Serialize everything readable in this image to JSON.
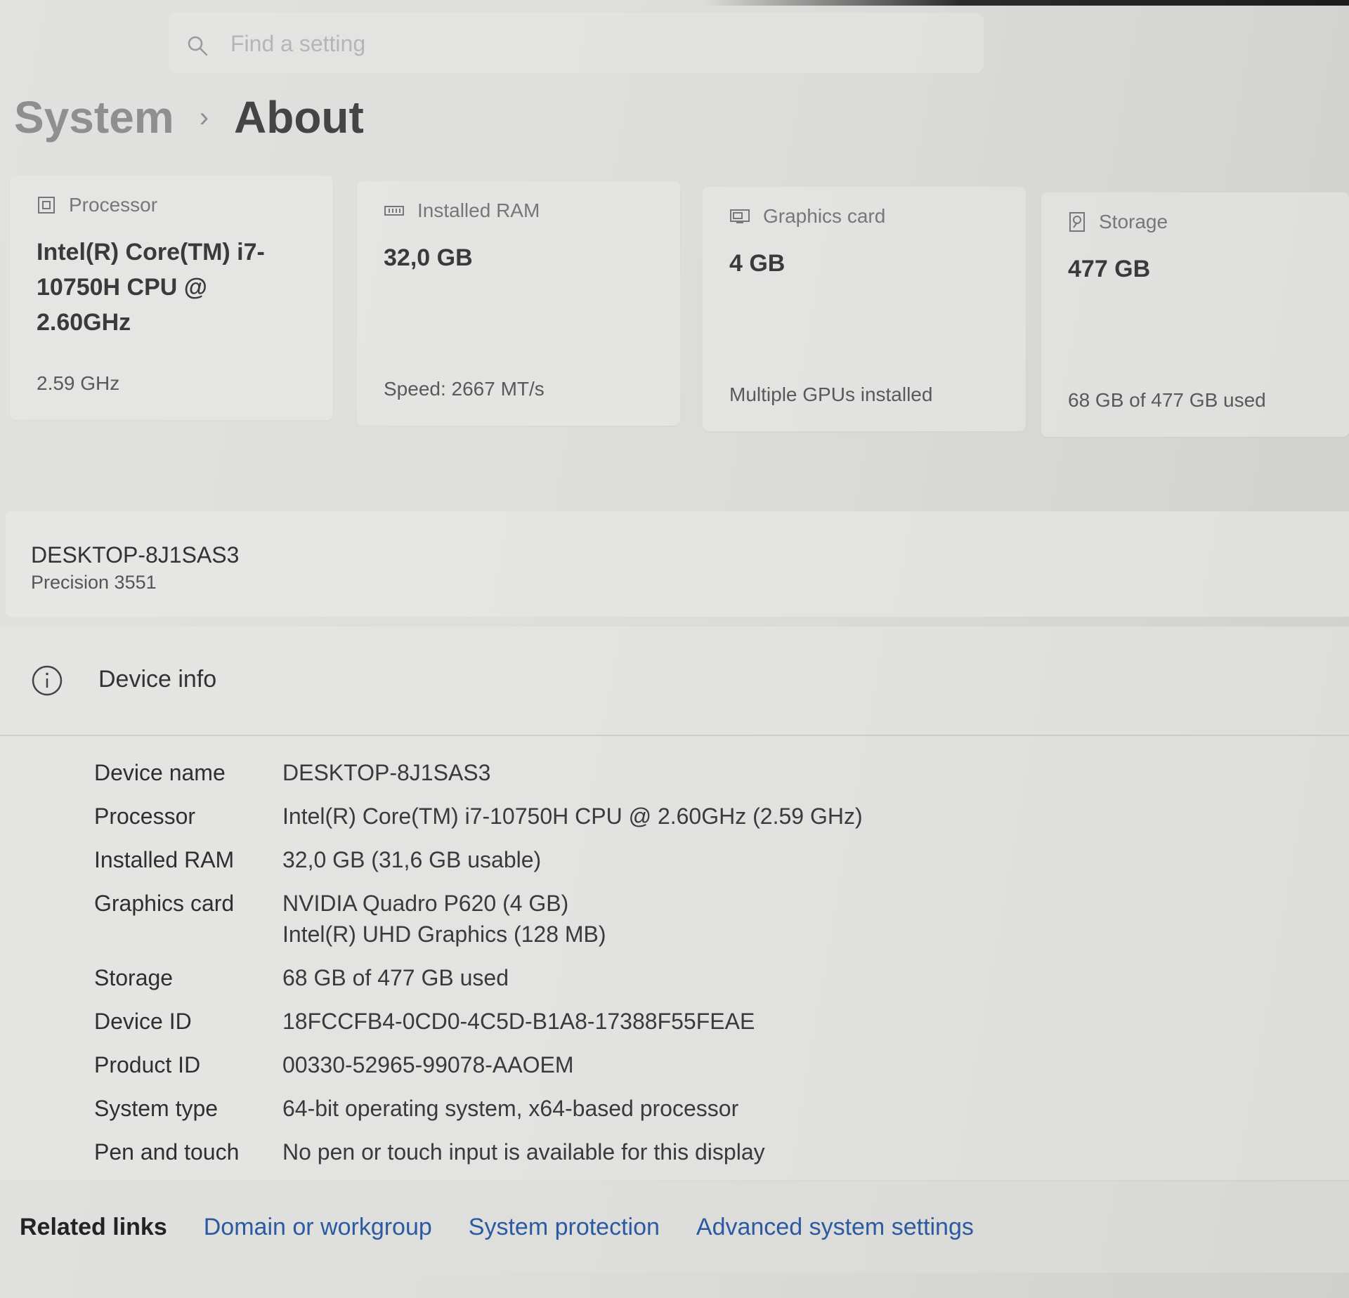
{
  "search": {
    "placeholder": "Find a setting"
  },
  "breadcrumb": {
    "parent": "System",
    "separator": "›",
    "current": "About"
  },
  "cards": [
    {
      "icon": "processor-icon",
      "label": "Processor",
      "value": "Intel(R) Core(TM) i7-10750H CPU @ 2.60GHz",
      "sub": "2.59 GHz"
    },
    {
      "icon": "ram-icon",
      "label": "Installed RAM",
      "value": "32,0 GB",
      "sub": "Speed: 2667 MT/s"
    },
    {
      "icon": "graphics-card-icon",
      "label": "Graphics card",
      "value": "4 GB",
      "sub": "Multiple GPUs installed"
    },
    {
      "icon": "storage-icon",
      "label": "Storage",
      "value": "477 GB",
      "sub": "68 GB of 477 GB used"
    }
  ],
  "device": {
    "name": "DESKTOP-8J1SAS3",
    "model": "Precision 3551"
  },
  "device_info": {
    "title": "Device info",
    "icon": "info-icon",
    "rows": [
      {
        "key": "Device name",
        "value": "DESKTOP-8J1SAS3"
      },
      {
        "key": "Processor",
        "value": "Intel(R) Core(TM) i7-10750H CPU @ 2.60GHz (2.59 GHz)"
      },
      {
        "key": "Installed RAM",
        "value": "32,0 GB (31,6 GB usable)"
      },
      {
        "key": "Graphics card",
        "value": "NVIDIA Quadro P620 (4 GB)",
        "value2": "Intel(R) UHD Graphics (128 MB)"
      },
      {
        "key": "Storage",
        "value": "68 GB of 477 GB used"
      },
      {
        "key": "Device ID",
        "value": "18FCCFB4-0CD0-4C5D-B1A8-17388F55FEAE"
      },
      {
        "key": "Product ID",
        "value": "00330-52965-99078-AAOEM"
      },
      {
        "key": "System type",
        "value": "64-bit operating system, x64-based processor"
      },
      {
        "key": "Pen and touch",
        "value": "No pen or touch input is available for this display"
      }
    ]
  },
  "related": {
    "label": "Related links",
    "links": [
      "Domain or workgroup",
      "System protection",
      "Advanced system settings"
    ]
  },
  "colors": {
    "link": "#2b5aa0",
    "background": "#dddddb"
  }
}
